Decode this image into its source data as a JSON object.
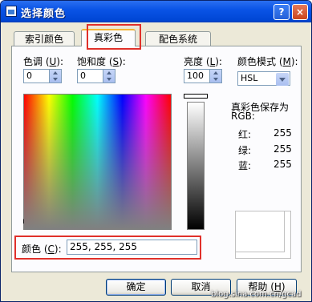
{
  "window": {
    "title": "选择颜色",
    "help": "?",
    "close": "×"
  },
  "tabs": [
    "索引颜色",
    "真彩色",
    "配色系统"
  ],
  "hue": {
    "label_pre": "色调 (",
    "key": "U",
    "label_post": "):",
    "value": "0"
  },
  "saturation": {
    "label_pre": "饱和度 (",
    "key": "S",
    "label_post": "):",
    "value": "0"
  },
  "luminance": {
    "label_pre": "亮度 (",
    "key": "L",
    "label_post": "):",
    "value": "100"
  },
  "color_mode": {
    "label_pre": "颜色模式 (",
    "key": "M",
    "label_post": "):",
    "value": "HSL"
  },
  "rgb_info": {
    "heading1": "真彩色保存为",
    "heading2": "RGB:",
    "red_label": "红:",
    "red": "255",
    "green_label": "绿:",
    "green": "255",
    "blue_label": "蓝:",
    "blue": "255"
  },
  "color_field": {
    "label_pre": "颜色 (",
    "key": "C",
    "label_post": "):",
    "value": "255, 255, 255"
  },
  "cursor_glyph": "ı",
  "buttons": {
    "ok": "确定",
    "cancel": "取消",
    "help_pre": "帮助 (",
    "help_key": "H",
    "help_post": ")"
  },
  "watermark": "blog.sina.com.cn/gcad",
  "colors": {
    "highlight": "#e0302a",
    "title_bar": "#0a54e6"
  }
}
